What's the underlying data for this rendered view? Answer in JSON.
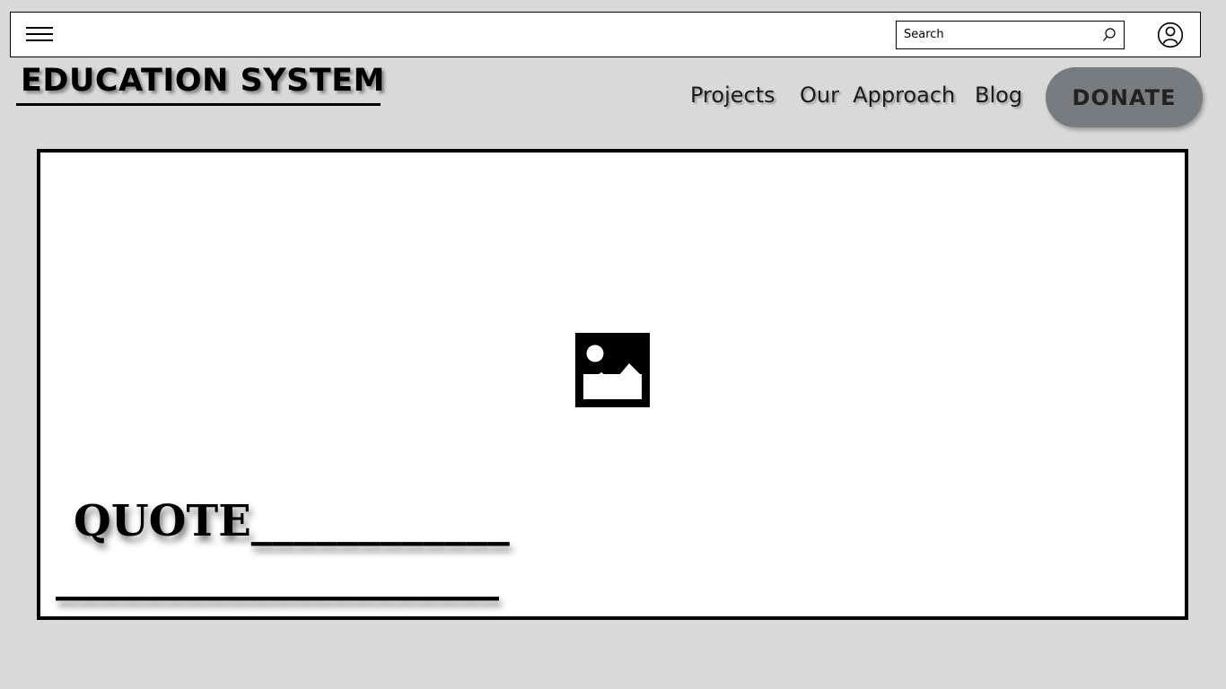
{
  "topbar": {
    "menu_icon": "hamburger-menu-icon",
    "search": {
      "placeholder": "Search",
      "value": "",
      "icon": "search-icon"
    },
    "account_icon": "user-account-icon"
  },
  "logo": {
    "text": "EDUCATION SYSTEM"
  },
  "nav": {
    "projects": "Projects",
    "approach": "Our  Approach",
    "blog": "Blog",
    "donate": "DONATE"
  },
  "hero": {
    "image_icon": "image-placeholder-icon",
    "quote_line_1": "QUOTE____________",
    "quote_line_2": "_____________________"
  },
  "colors": {
    "page_background": "#d9d9d9",
    "donate_background": "#777c80",
    "border": "#000000"
  }
}
